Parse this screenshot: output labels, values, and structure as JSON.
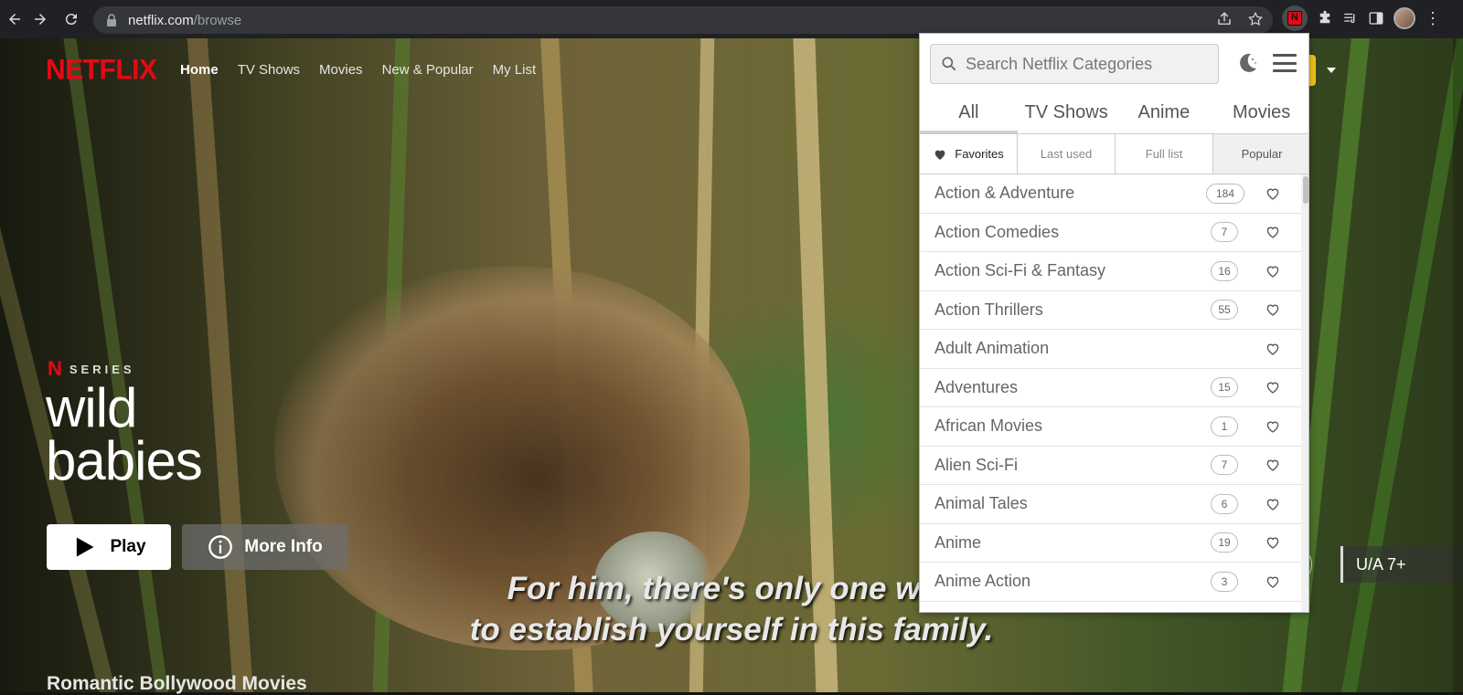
{
  "browser": {
    "url_host": "netflix.com",
    "url_path": "/browse"
  },
  "netflix": {
    "logo": "NETFLIX",
    "nav": [
      "Home",
      "TV Shows",
      "Movies",
      "New & Popular",
      "My List"
    ],
    "series_mark": "N",
    "series_label": "SERIES",
    "title_line1": "wild",
    "title_line2": "babies",
    "play_label": "Play",
    "info_label": "More Info",
    "subtitle_line1": "For him, there's only one way",
    "subtitle_line2": "to establish yourself in this family.",
    "row_title": "Romantic Bollywood Movies",
    "rating": "U/A 7+"
  },
  "popup": {
    "search_placeholder": "Search Netflix Categories",
    "tabs": [
      "All",
      "TV Shows",
      "Anime",
      "Movies"
    ],
    "subtabs": [
      "Favorites",
      "Last used",
      "Full list",
      "Popular"
    ],
    "categories": [
      {
        "name": "Action & Adventure",
        "count": "184"
      },
      {
        "name": "Action Comedies",
        "count": "7"
      },
      {
        "name": "Action Sci-Fi & Fantasy",
        "count": "16"
      },
      {
        "name": "Action Thrillers",
        "count": "55"
      },
      {
        "name": "Adult Animation",
        "count": ""
      },
      {
        "name": "Adventures",
        "count": "15"
      },
      {
        "name": "African Movies",
        "count": "1"
      },
      {
        "name": "Alien Sci-Fi",
        "count": "7"
      },
      {
        "name": "Animal Tales",
        "count": "6"
      },
      {
        "name": "Anime",
        "count": "19"
      },
      {
        "name": "Anime Action",
        "count": "3"
      },
      {
        "name": "",
        "count": ""
      }
    ]
  },
  "colors": {
    "netflix_red": "#e50914",
    "chrome_bg": "#202124",
    "profile_yellow": "#f4c21b"
  }
}
